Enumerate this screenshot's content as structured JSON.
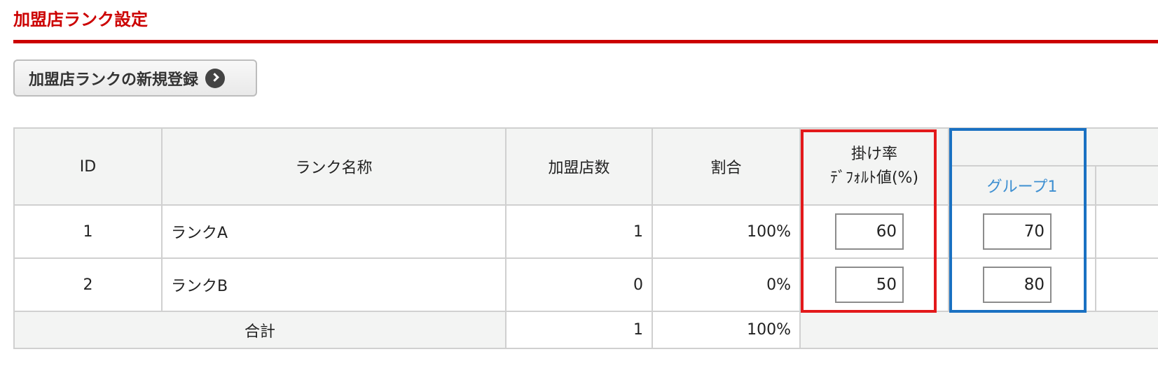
{
  "page": {
    "title": "加盟店ランク設定"
  },
  "actions": {
    "register_label": "加盟店ランクの新規登録"
  },
  "table": {
    "headers": {
      "id": "ID",
      "name": "ランク名称",
      "store_count": "加盟店数",
      "ratio": "割合",
      "rate_line1": "掛け率",
      "rate_line2": "ﾃﾞﾌｫﾙﾄ値(%)",
      "group1": "グループ1"
    },
    "rows": [
      {
        "id": "1",
        "name": "ランクA",
        "store_count": "1",
        "ratio": "100%",
        "default_rate": "60",
        "group1_rate": "70"
      },
      {
        "id": "2",
        "name": "ランクB",
        "store_count": "0",
        "ratio": "0%",
        "default_rate": "50",
        "group1_rate": "80"
      }
    ],
    "total": {
      "label": "合計",
      "store_count": "1",
      "ratio": "100%"
    }
  },
  "highlights": {
    "rate_column_color": "#e3191b",
    "group_column_color": "#1a71c2"
  }
}
